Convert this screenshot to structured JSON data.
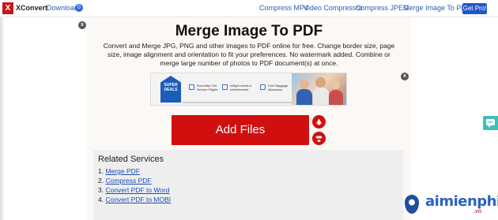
{
  "app": {
    "logo_letter": "X",
    "brand": "XConvert"
  },
  "nav": {
    "downloads_label": "Downloads",
    "downloads_count": "0",
    "links": [
      "Compress MP4",
      "Video Compressor",
      "Compress JPEG",
      "Merge Image To PDF"
    ],
    "get_pro_label": "Get Pro!"
  },
  "main": {
    "title": "Merge Image To PDF",
    "description": "Convert and Merge JPG, PNG and other images to PDF online for free. Change border size, page size, image alignment and orientation to fit your preferences. No watermark added. Combine or merge large number of photos to PDF document(s) at once.",
    "add_files_label": "Add Files",
    "close_glyph": "x"
  },
  "ad": {
    "badge_text": "SUPER DEALS",
    "items": [
      "Roundtrip Full Service Flights",
      "Inflight meals & refreshments",
      "Free Baggage Allowance"
    ]
  },
  "related": {
    "title": "Related Services",
    "items": [
      {
        "num": "1.",
        "label": "Merge PDF"
      },
      {
        "num": "2.",
        "label": "Compress PDF"
      },
      {
        "num": "3.",
        "label": "Convert PDF to Word"
      },
      {
        "num": "4.",
        "label": "Convert PDF to MOBI"
      }
    ]
  },
  "watermark": {
    "main": "aimienphi",
    "sub": ".vn"
  },
  "colors": {
    "accent_red": "#d20f0f",
    "link_blue": "#2a5db0",
    "pro_blue": "#2356c7",
    "chat_teal": "#3fbfb7"
  }
}
